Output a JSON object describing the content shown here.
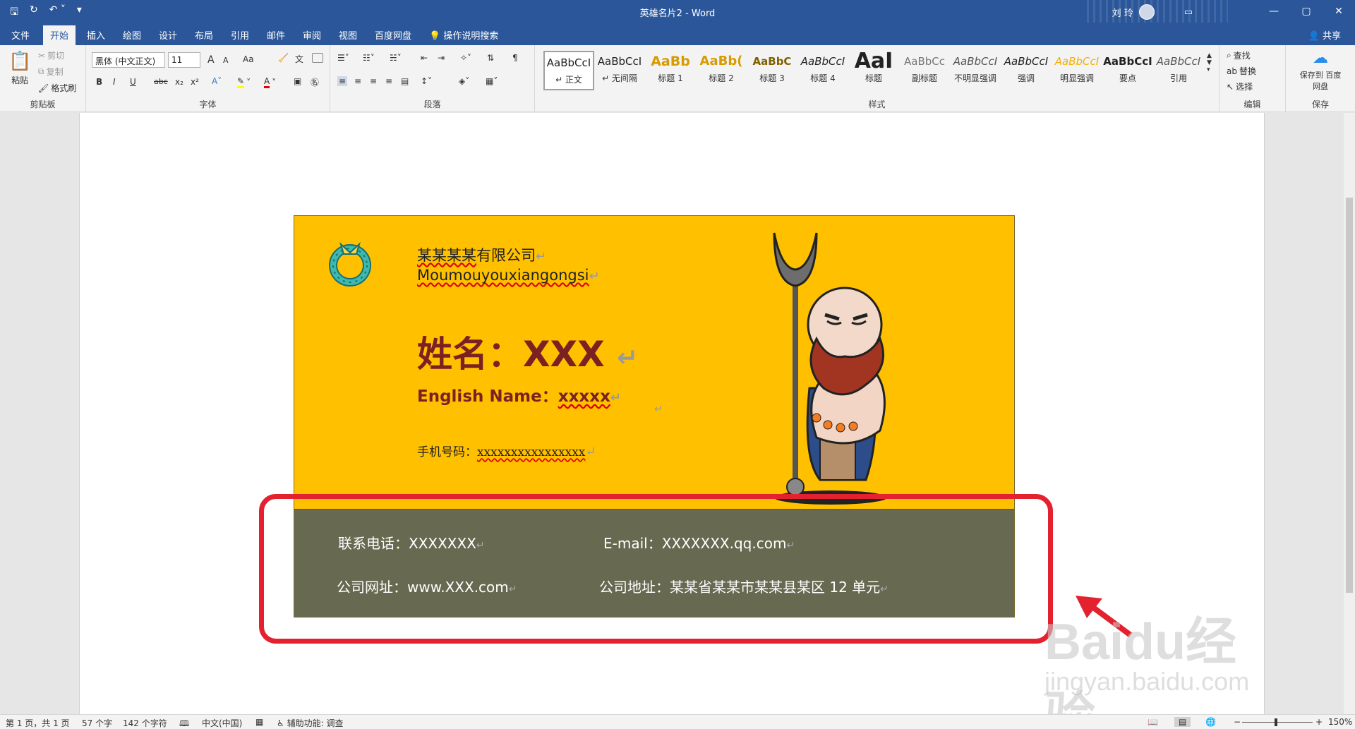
{
  "window": {
    "title": "英雄名片2 - Word",
    "user": "刘 玲",
    "controls": [
      "—",
      "▢",
      "✕"
    ]
  },
  "tabs": [
    "文件",
    "开始",
    "插入",
    "绘图",
    "设计",
    "布局",
    "引用",
    "邮件",
    "审阅",
    "视图",
    "百度网盘",
    "操作说明搜索"
  ],
  "active_tab": "开始",
  "share": "共享",
  "clipboard": {
    "paste": "粘贴",
    "cut": "剪切",
    "copy": "复制",
    "format_painter": "格式刷",
    "label": "剪贴板"
  },
  "font": {
    "family": "黑体 (中文正文)",
    "size": "11",
    "case": "Aa",
    "label": "字体",
    "bold": "B",
    "italic": "I",
    "underline": "U",
    "strike": "abc",
    "sub": "x₂",
    "sup": "x²",
    "grow": "A",
    "shrink": "A"
  },
  "paragraph": {
    "label": "段落"
  },
  "styles": {
    "label": "样式",
    "items": [
      {
        "sample": "AaBbCcI",
        "name": "↵ 正文"
      },
      {
        "sample": "AaBbCcI",
        "name": "↵ 无间隔"
      },
      {
        "sample": "AaBb",
        "name": "标题 1"
      },
      {
        "sample": "AaBb(",
        "name": "标题 2"
      },
      {
        "sample": "AaBbC",
        "name": "标题 3"
      },
      {
        "sample": "AaBbCcI",
        "name": "标题 4"
      },
      {
        "sample": "AaI",
        "name": "标题"
      },
      {
        "sample": "AaBbCc",
        "name": "副标题"
      },
      {
        "sample": "AaBbCcI",
        "name": "不明显强调"
      },
      {
        "sample": "AaBbCcI",
        "name": "强调"
      },
      {
        "sample": "AaBbCcI",
        "name": "明显强调"
      },
      {
        "sample": "AaBbCcI",
        "name": "要点"
      },
      {
        "sample": "AaBbCcI",
        "name": "引用"
      }
    ]
  },
  "editing": {
    "find": "查找",
    "replace": "替换",
    "select": "选择",
    "label": "编辑"
  },
  "save": {
    "btn": "保存到 百度网盘",
    "label": "保存"
  },
  "card": {
    "company_cn_wavy": "某某某某",
    "company_cn_rest": "有限公司",
    "company_en": "Moumouyouxiangongsi",
    "name": "姓名：XXX",
    "english_label": "English Name：",
    "english_value": "xxxxx",
    "phone_label": "手机号码：",
    "phone_value": "xxxxxxxxxxxxxxxx",
    "contact_phone": "联系电话：XXXXXXX",
    "email": "E-mail：XXXXXXX.qq.com",
    "website": "公司网址：www.XXX.com",
    "address": "公司地址：某某省某某市某某县某区 12 单元",
    "pilcrow": "↵"
  },
  "watermark": {
    "big": "Baidu经验",
    "small": "jingyan.baidu.com"
  },
  "status": {
    "page": "第 1 页，共 1 页",
    "words": "57 个字",
    "chars": "142 个字符",
    "lang": "中文(中国)",
    "accessibility": "辅助功能: 调查",
    "zoom": "150%"
  },
  "colors": {
    "brand": "#2b579a",
    "card_top": "#ffc000",
    "card_bottom": "#686951",
    "title_text": "#7b2121",
    "highlight": "#e3212f"
  }
}
